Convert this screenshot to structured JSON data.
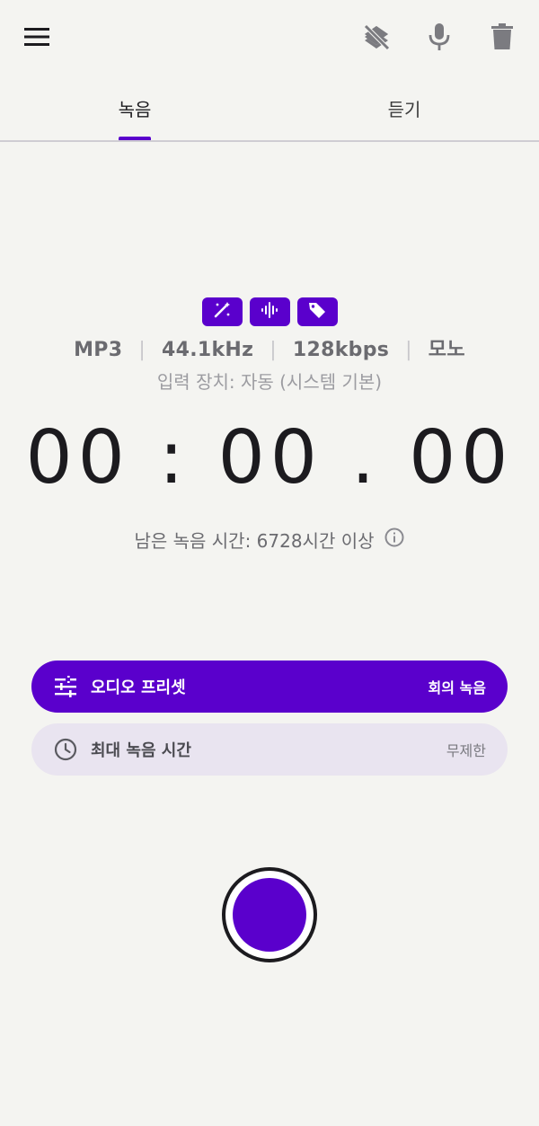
{
  "colors": {
    "accent": "#5a00cc",
    "background": "#f4f4f1",
    "secondary_row": "#e9e4f0",
    "text_primary": "#1c1b1f",
    "text_secondary": "#6b6b70"
  },
  "topbar": {
    "menu_icon": "menu-icon",
    "actions": [
      {
        "icon": "layers-off-icon"
      },
      {
        "icon": "microphone-icon"
      },
      {
        "icon": "trash-icon"
      }
    ]
  },
  "tabs": [
    {
      "label": "녹음",
      "selected": true
    },
    {
      "label": "듣기",
      "selected": false
    }
  ],
  "chips": [
    {
      "icon": "magic-wand-icon"
    },
    {
      "icon": "waveform-icon"
    },
    {
      "icon": "tag-icon"
    }
  ],
  "format": {
    "codec": "MP3",
    "sample_rate": "44.1kHz",
    "bitrate": "128kbps",
    "channels": "모노",
    "separator": "|"
  },
  "input_device": "입력 장치: 자동 (시스템 기본)",
  "timer": "00 : 00 . 00",
  "remaining_time": "남은 녹음 시간: 6728시간 이상",
  "preset": {
    "label": "오디오 프리셋",
    "value": "회의 녹음"
  },
  "max_time": {
    "label": "최대 녹음 시간",
    "value": "무제한"
  }
}
